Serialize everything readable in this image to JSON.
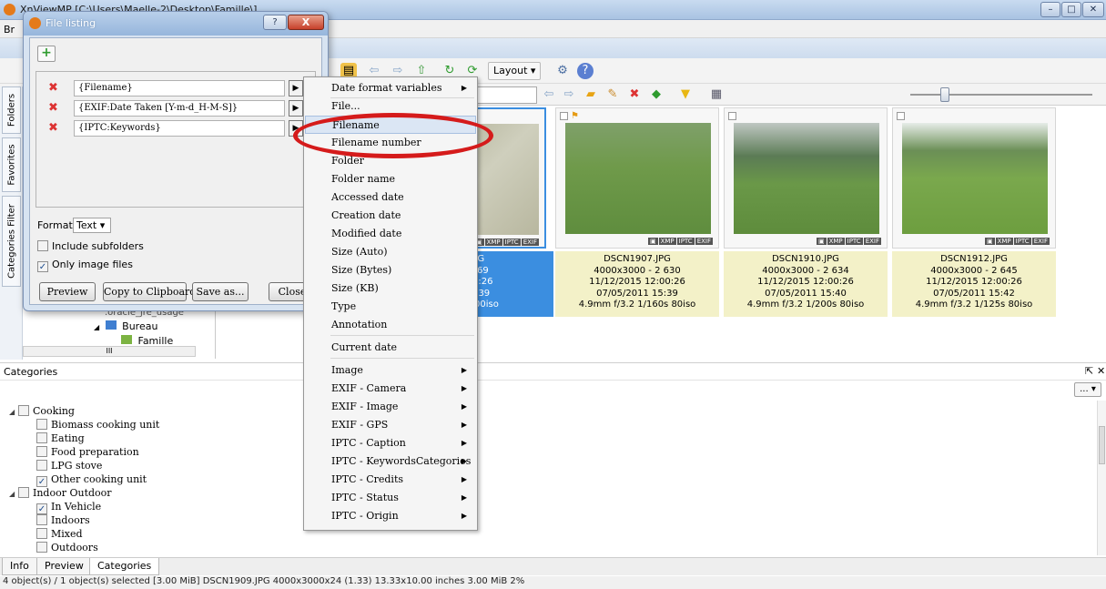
{
  "window": {
    "title": "XnViewMP [C:\\Users\\Maelle-2\\Desktop\\Famille\\]",
    "controls": [
      "–",
      "□",
      "✕"
    ]
  },
  "menubar": {
    "first_letter": "Br"
  },
  "toolbar": {
    "layout_label": "Layout",
    "search_placeholder": "ch"
  },
  "side_tabs": [
    "Folders",
    "Favorites",
    "Categories Filter"
  ],
  "folder_tree": {
    "items": [
      ".oracle_jre_usage",
      "Bureau",
      "Famille"
    ],
    "h_scroll_label": "III"
  },
  "thumbnails": [
    {
      "name": "9.JPG",
      "dims": "- 3 069",
      "date1": "12:00:26",
      "date2": "1 15:39",
      "exif": "/60s 200iso",
      "selected": true
    },
    {
      "name": "DSCN1907.JPG",
      "dims": "4000x3000 - 2 630",
      "date1": "11/12/2015 12:00:26",
      "date2": "07/05/2011 15:39",
      "exif": "4.9mm f/3.2 1/160s 80iso",
      "selected": false
    },
    {
      "name": "DSCN1910.JPG",
      "dims": "4000x3000 - 2 634",
      "date1": "11/12/2015 12:00:26",
      "date2": "07/05/2011 15:40",
      "exif": "4.9mm f/3.2 1/200s 80iso",
      "selected": false
    },
    {
      "name": "DSCN1912.JPG",
      "dims": "4000x3000 - 2 645",
      "date1": "11/12/2015 12:00:26",
      "date2": "07/05/2011 15:42",
      "exif": "4.9mm f/3.2 1/125s 80iso",
      "selected": false
    }
  ],
  "thumb_badges": [
    "▣",
    "XMP",
    "IPTC",
    "EXIF"
  ],
  "categories": {
    "header": "Categories",
    "filter_button": "...",
    "rows": [
      {
        "label": "Cooking",
        "level": 0,
        "checked": false,
        "expand": "◢"
      },
      {
        "label": "Biomass cooking unit",
        "level": 1,
        "checked": false
      },
      {
        "label": "Eating",
        "level": 1,
        "checked": false
      },
      {
        "label": "Food preparation",
        "level": 1,
        "checked": false
      },
      {
        "label": "LPG stove",
        "level": 1,
        "checked": false
      },
      {
        "label": "Other cooking unit",
        "level": 1,
        "checked": true
      },
      {
        "label": "Indoor Outdoor",
        "level": 0,
        "checked": false,
        "expand": "◢"
      },
      {
        "label": "In Vehicle",
        "level": 1,
        "checked": true
      },
      {
        "label": "Indoors",
        "level": 1,
        "checked": false
      },
      {
        "label": "Mixed",
        "level": 1,
        "checked": false
      },
      {
        "label": "Outdoors",
        "level": 1,
        "checked": false
      }
    ]
  },
  "bottom_tabs": [
    "Info",
    "Preview",
    "Categories"
  ],
  "statusbar": "4 object(s) / 1 object(s) selected [3.00 MiB]  DSCN1909.JPG  4000x3000x24 (1.33)  13.33x10.00 inches  3.00 MiB  2%",
  "dialog": {
    "title": "File listing",
    "help": "?",
    "close": "X",
    "fields": [
      "{Filename}",
      "{EXIF:Date Taken [Y-m-d_H-M-S]}",
      "{IPTC:Keywords}"
    ],
    "format_label": "Format",
    "format_value": "Text",
    "include_subfolders": "Include subfolders",
    "include_subfolders_checked": false,
    "only_images": "Only image files",
    "only_images_checked": true,
    "buttons": {
      "preview": "Preview",
      "copy": "Copy to Clipboard",
      "save": "Save as...",
      "close": "Close"
    }
  },
  "context_menu": {
    "items": [
      {
        "label": "Date format variables",
        "sub": true
      },
      {
        "label": "File...",
        "sub": false
      },
      {
        "label": "Filename",
        "sub": false,
        "highlight": true
      },
      {
        "label": "Filename number",
        "sub": false
      },
      {
        "label": "Folder",
        "sub": false
      },
      {
        "label": "Folder name",
        "sub": false
      },
      {
        "label": "Accessed date",
        "sub": false
      },
      {
        "label": "Creation date",
        "sub": false
      },
      {
        "label": "Modified date",
        "sub": false
      },
      {
        "label": "Size (Auto)",
        "sub": false
      },
      {
        "label": "Size (Bytes)",
        "sub": false
      },
      {
        "label": "Size (KB)",
        "sub": false
      },
      {
        "label": "Type",
        "sub": false
      },
      {
        "label": "Annotation",
        "sub": false
      },
      {
        "label": "Current date",
        "sub": false
      },
      {
        "label": "Image",
        "sub": true
      },
      {
        "label": "EXIF - Camera",
        "sub": true
      },
      {
        "label": "EXIF - Image",
        "sub": true
      },
      {
        "label": "EXIF - GPS",
        "sub": true
      },
      {
        "label": "IPTC - Caption",
        "sub": true
      },
      {
        "label": "IPTC - KeywordsCategories",
        "sub": true
      },
      {
        "label": "IPTC - Credits",
        "sub": true
      },
      {
        "label": "IPTC - Status",
        "sub": true
      },
      {
        "label": "IPTC - Origin",
        "sub": true
      }
    ],
    "submenu_arrow": "▶"
  },
  "colors": {
    "highlight_circle": "#d51b1b",
    "selection": "#3b8ee0",
    "info_background": "#f3f1c8"
  }
}
